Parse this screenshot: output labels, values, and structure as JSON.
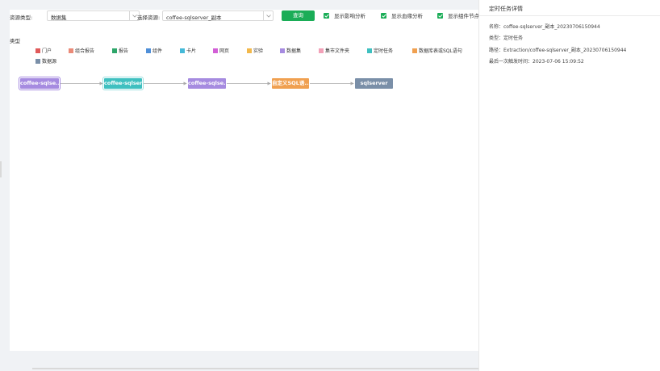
{
  "toolbar": {
    "resource_type_label": "资源类型:",
    "resource_type_value": "数据集",
    "select_resource_label": "选择资源:",
    "select_resource_value": "coffee-sqlserver_副本",
    "query_button": "查询",
    "checkboxes": [
      {
        "label": "显示影响分析",
        "checked": true
      },
      {
        "label": "显示血缘分析",
        "checked": true
      },
      {
        "label": "显示组件节点",
        "checked": true
      }
    ]
  },
  "legend": {
    "title": "类型",
    "items": [
      {
        "label": "门户",
        "color": "#e05a5a"
      },
      {
        "label": "组合报告",
        "color": "#ea8a78"
      },
      {
        "label": "报告",
        "color": "#2ea66a"
      },
      {
        "label": "组件",
        "color": "#4f8fd8"
      },
      {
        "label": "卡片",
        "color": "#45b9d8"
      },
      {
        "label": "网页",
        "color": "#d25fd6"
      },
      {
        "label": "实验",
        "color": "#f2b84b"
      },
      {
        "label": "数据集",
        "color": "#a68be0"
      },
      {
        "label": "集市文件夹",
        "color": "#f2a1b8"
      },
      {
        "label": "定时任务",
        "color": "#3fc0c0"
      },
      {
        "label": "数据库表或SQL语句",
        "color": "#f0a050"
      },
      {
        "label": "数据源",
        "color": "#7a8fa8"
      }
    ]
  },
  "flow": {
    "nodes": [
      {
        "label": "coffee-sqlse...",
        "color": "#a68be0",
        "selected": true
      },
      {
        "label": "coffee-sqlser...",
        "color": "#3fc0c0",
        "selected": true
      },
      {
        "label": "coffee-sqlse...",
        "color": "#a68be0",
        "selected": false
      },
      {
        "label": "自定义SQL语...",
        "color": "#f0a050",
        "selected": false
      },
      {
        "label": "sqlserver",
        "color": "#7a8fa8",
        "selected": false
      }
    ]
  },
  "panel": {
    "title": "定时任务详情",
    "name": "名称：coffee-sqlserver_副本_20230706150944",
    "type": "类型：定时任务",
    "path": "路径：Extraction/coffee-sqlserver_副本_20230706150944",
    "last_trigger": "最后一次触发时间：2023-07-06 15:09:52"
  }
}
